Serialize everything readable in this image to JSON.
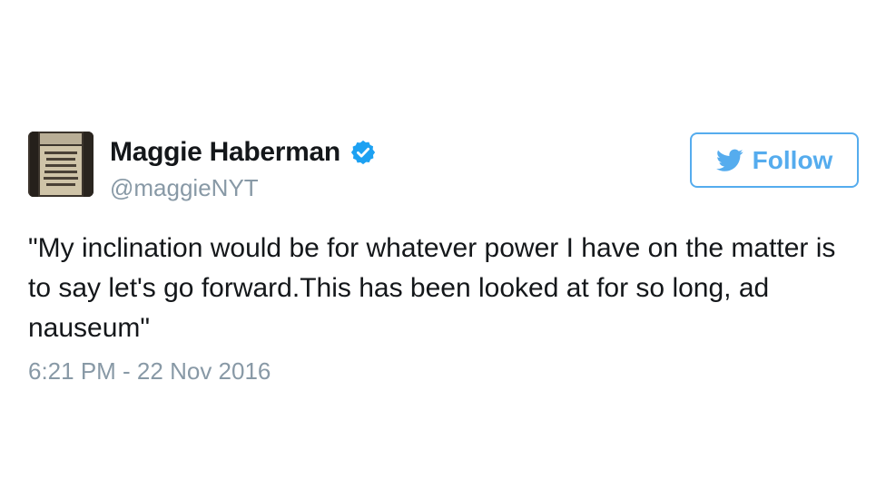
{
  "tweet": {
    "display_name": "Maggie Haberman",
    "handle": "@maggieNYT",
    "verified_icon": "verified-badge-icon",
    "follow_label": "Follow",
    "follow_icon": "twitter-bird-icon",
    "text": "\"My inclination would be for whatever power I have on the matter is to say let's go forward.This has been looked at for so long, ad nauseum\"",
    "timestamp": "6:21 PM - 22 Nov 2016"
  },
  "colors": {
    "accent": "#55acee",
    "verified": "#1da1f2",
    "muted": "#8899a6",
    "text": "#14171a"
  }
}
